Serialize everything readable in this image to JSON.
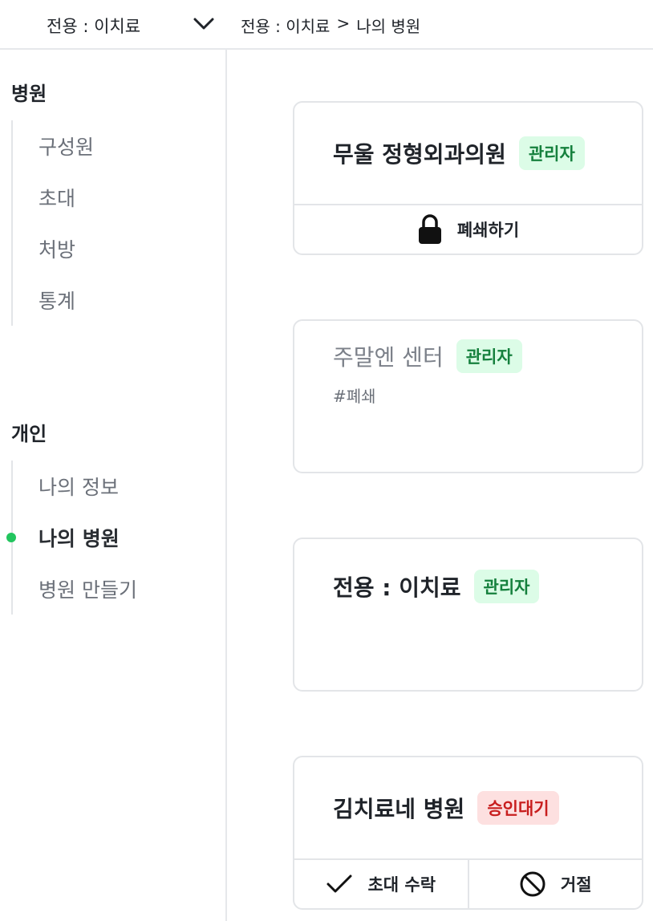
{
  "topbar": {
    "org_selector": "전용 : 이치료",
    "breadcrumb": [
      "전용 : 이치료",
      ">",
      "나의 병원"
    ]
  },
  "sidebar": {
    "sections": [
      {
        "title": "병원",
        "items": [
          "구성원",
          "초대",
          "처방",
          "통계"
        ]
      },
      {
        "title": "개인",
        "items": [
          "나의 정보",
          "나의 병원",
          "병원 만들기"
        ],
        "active": "나의 병원"
      }
    ]
  },
  "cards": [
    {
      "name": "무울 정형외과의원",
      "badge": "관리자",
      "badge_type": "admin",
      "actions": [
        {
          "icon": "lock-icon",
          "label": "폐쇄하기"
        }
      ]
    },
    {
      "name": "주말엔 센터",
      "badge": "관리자",
      "badge_type": "admin",
      "tag": "#폐쇄"
    },
    {
      "name": "전용 : 이치료",
      "badge": "관리자",
      "badge_type": "admin"
    },
    {
      "name": "김치료네 병원",
      "badge": "승인대기",
      "badge_type": "pending",
      "actions": [
        {
          "icon": "check-icon",
          "label": "초대 수락"
        },
        {
          "icon": "block-icon",
          "label": "거절"
        }
      ]
    }
  ],
  "colors": {
    "accent": "#22c55e",
    "admin_badge_bg": "#dcfce7",
    "pending_badge_bg": "#fde0e0"
  }
}
